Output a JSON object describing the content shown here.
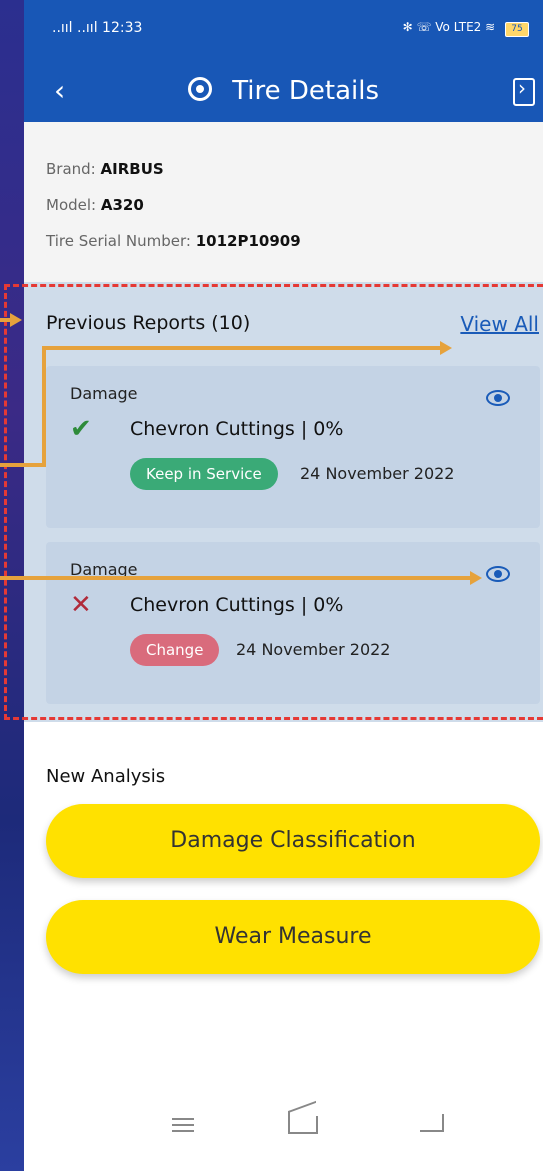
{
  "status_bar": {
    "time_signal": "..ııl ..ııl 12:33",
    "right_icons": "✻ ☏ Vo LTE2 ≋",
    "battery": "75"
  },
  "header": {
    "back_glyph": "‹",
    "title": "Tire Details"
  },
  "info": {
    "brand_label": "Brand:",
    "brand_value": "AIRBUS",
    "model_label": "Model:",
    "model_value": "A320",
    "serial_label": "Tire Serial Number:",
    "serial_value": "1012P10909"
  },
  "reports": {
    "title": "Previous Reports (10)",
    "view_all": "View All",
    "items": [
      {
        "kind": "Damage",
        "name": "Chevron Cuttings | 0%",
        "status": "Keep in Service",
        "date": "24 November 2022",
        "icon": "check-icon",
        "pill_color": "#3aaa77"
      },
      {
        "kind": "Damage",
        "name": "Chevron Cuttings | 0%",
        "status": "Change",
        "date": "24 November 2022",
        "icon": "cross-icon",
        "pill_color": "#d96b7c"
      }
    ]
  },
  "new_analysis": {
    "title": "New Analysis",
    "buttons": [
      "Damage Classification",
      "Wear Measure"
    ]
  },
  "colors": {
    "primary": "#1857b6",
    "accent_yellow": "#ffe100",
    "annotation": "#e6a23c",
    "dash": "#e53935"
  }
}
